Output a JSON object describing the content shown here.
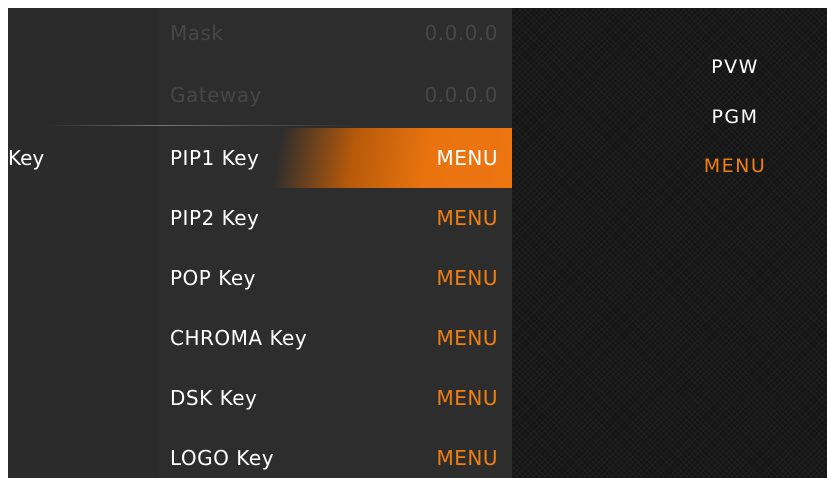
{
  "category": {
    "label": "Key"
  },
  "menu": {
    "items": [
      {
        "label": "Mask",
        "value": "0.0.0.0",
        "state": "disabled"
      },
      {
        "label": "Gateway",
        "value": "0.0.0.0",
        "state": "disabled"
      },
      {
        "label": "PIP1 Key",
        "value": "MENU",
        "state": "selected"
      },
      {
        "label": "PIP2 Key",
        "value": "MENU",
        "state": "normal"
      },
      {
        "label": "POP Key",
        "value": "MENU",
        "state": "normal"
      },
      {
        "label": "CHROMA Key",
        "value": "MENU",
        "state": "normal"
      },
      {
        "label": "DSK Key",
        "value": "MENU",
        "state": "normal"
      },
      {
        "label": "LOGO Key",
        "value": "MENU",
        "state": "normal"
      }
    ]
  },
  "status": {
    "pvw": "PVW",
    "pgm": "PGM",
    "menu": "MENU"
  },
  "colors": {
    "accent": "#f07f12",
    "panel": "#2d2d2d",
    "status_bg": "#151515",
    "disabled_text": "#474747"
  }
}
